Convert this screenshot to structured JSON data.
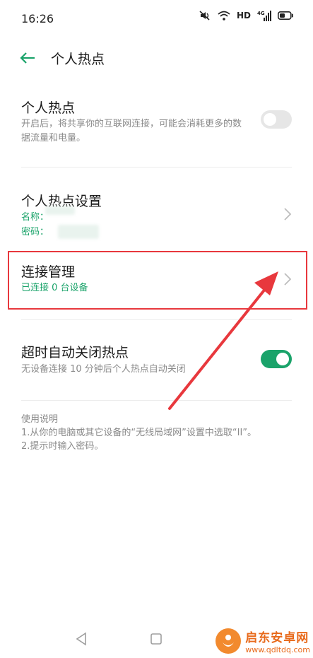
{
  "status_bar": {
    "time": "16:26",
    "hd": "HD",
    "signal": "4G"
  },
  "header": {
    "title": "个人热点",
    "back_icon": "arrow-left-icon"
  },
  "hotspot": {
    "title": "个人热点",
    "description": "开启后，将共享你的互联网连接，可能会消耗更多的数据流量和电量。",
    "enabled": false
  },
  "hotspot_settings": {
    "title": "个人热点设置",
    "name_label": "名称：",
    "password_label": "密码："
  },
  "connection_manage": {
    "title": "连接管理",
    "status": "已连接 0 台设备"
  },
  "auto_close": {
    "title": "超时自动关闭热点",
    "description": "无设备连接 10 分钟后个人热点自动关闭",
    "enabled": true
  },
  "instructions": {
    "title": "使用说明",
    "lines": [
      "1.从你的电脑或其它设备的“无线局域网”设置中选取“II”。",
      "2.提示时输入密码。"
    ]
  },
  "colors": {
    "accent": "#1aa36a",
    "annotation": "#e8383d"
  },
  "watermark": {
    "title": "启东安卓网",
    "url": "www.qdltdq.com"
  }
}
